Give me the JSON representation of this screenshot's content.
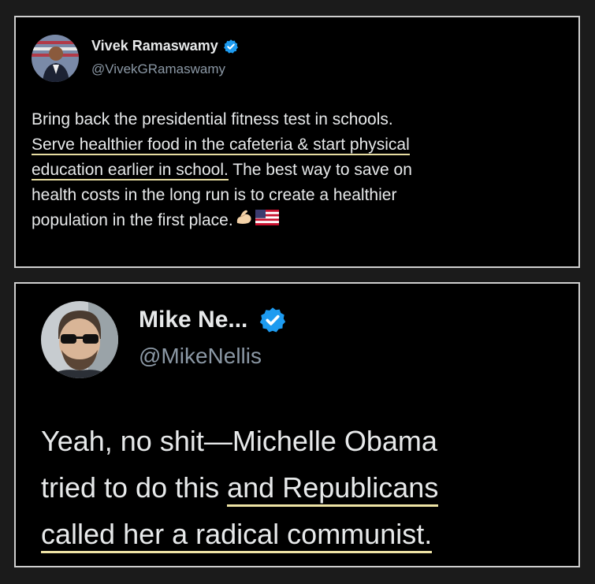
{
  "tweet1": {
    "author_name": "Vivek Ramaswamy",
    "handle": "@VivekGRamaswamy",
    "verified_icon": "verified-badge-icon",
    "avatar_icon": "avatar-photo",
    "lines": [
      "Bring back the presidential fitness test in schools.",
      "Serve healthier food in the cafeteria & start physical",
      "education earlier in school.",
      " The best way to save on",
      "health costs in the long run is to create a healthier",
      "population in the first place."
    ],
    "emoji_icons": [
      "flexed-biceps-icon",
      "us-flag-icon"
    ]
  },
  "tweet2": {
    "author_name": "Mike Ne...",
    "handle": "@MikeNellis",
    "verified_icon": "verified-badge-icon",
    "avatar_icon": "avatar-photo",
    "lines": [
      "Yeah, no shit—Michelle Obama",
      "tried to do this ",
      "and Republicans",
      "called her a radical communist."
    ]
  },
  "colors": {
    "background": "#1b1b1b",
    "card": "#000000",
    "border": "#cfcfcf",
    "text": "#e7e9ea",
    "handle": "#8b98a5",
    "verified": "#1d9bf0",
    "underline": "#e6dca0"
  }
}
